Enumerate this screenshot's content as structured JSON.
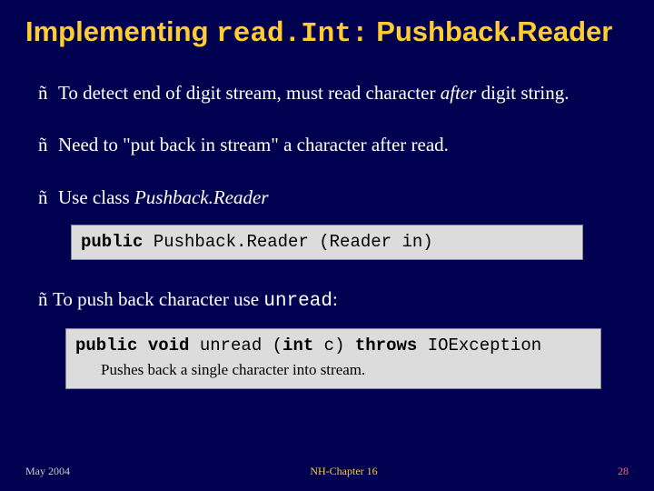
{
  "title": {
    "pre": "Implementing ",
    "code": "read.Int:",
    "post": " Pushback.Reader"
  },
  "bullets": {
    "marker": "ñ",
    "b1_pre": "To detect end of digit stream, must read character ",
    "b1_em": "after",
    "b1_post": " digit string.",
    "b2": "Need to \"put back in stream\" a character after read.",
    "b3_pre": "Use class ",
    "b3_em": "Pushback.Reader",
    "b4_pre": "To push back character use ",
    "b4_code": "unread",
    "b4_post": ":"
  },
  "code1": {
    "kw": "public",
    "rest": " Pushback.Reader (Reader in)"
  },
  "code2": {
    "kw1": "public void",
    "mid": " unread (",
    "kw2": "int",
    "mid2": " c) ",
    "kw3": "throws",
    "rest": " IOException",
    "caption": "Pushes back a single character into stream."
  },
  "footer": {
    "left": "May 2004",
    "center": "NH-Chapter 16",
    "right": "28"
  }
}
